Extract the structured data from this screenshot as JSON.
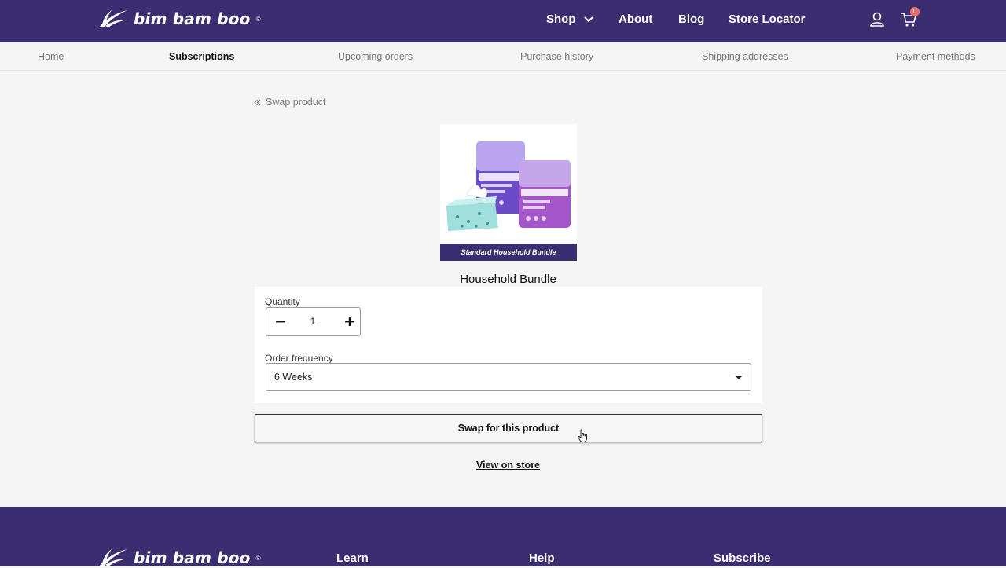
{
  "header": {
    "brand": "bim bam boo",
    "nav": [
      {
        "label": "Shop"
      },
      {
        "label": "About"
      },
      {
        "label": "Blog"
      },
      {
        "label": "Store Locator"
      }
    ],
    "cart_count": "0"
  },
  "subnav": {
    "items": [
      {
        "label": "Home"
      },
      {
        "label": "Subscriptions"
      },
      {
        "label": "Upcoming orders"
      },
      {
        "label": "Purchase history"
      },
      {
        "label": "Shipping addresses"
      },
      {
        "label": "Payment methods"
      }
    ],
    "active": "Subscriptions"
  },
  "main": {
    "back_label": "Swap product",
    "product_image_banner": "Standard Household Bundle",
    "product_title": "Household Bundle",
    "quantity_label": "Quantity",
    "quantity_value": "1",
    "frequency_label": "Order frequency",
    "frequency_value": "6 Weeks",
    "swap_button": "Swap for this product",
    "view_link": "View on store"
  },
  "footer": {
    "brand": "bim bam boo",
    "columns": [
      {
        "label": "Learn"
      },
      {
        "label": "Help"
      },
      {
        "label": "Subscribe"
      }
    ]
  },
  "colors": {
    "brand_purple": "#3a2d70",
    "badge": "#f26b6b"
  }
}
